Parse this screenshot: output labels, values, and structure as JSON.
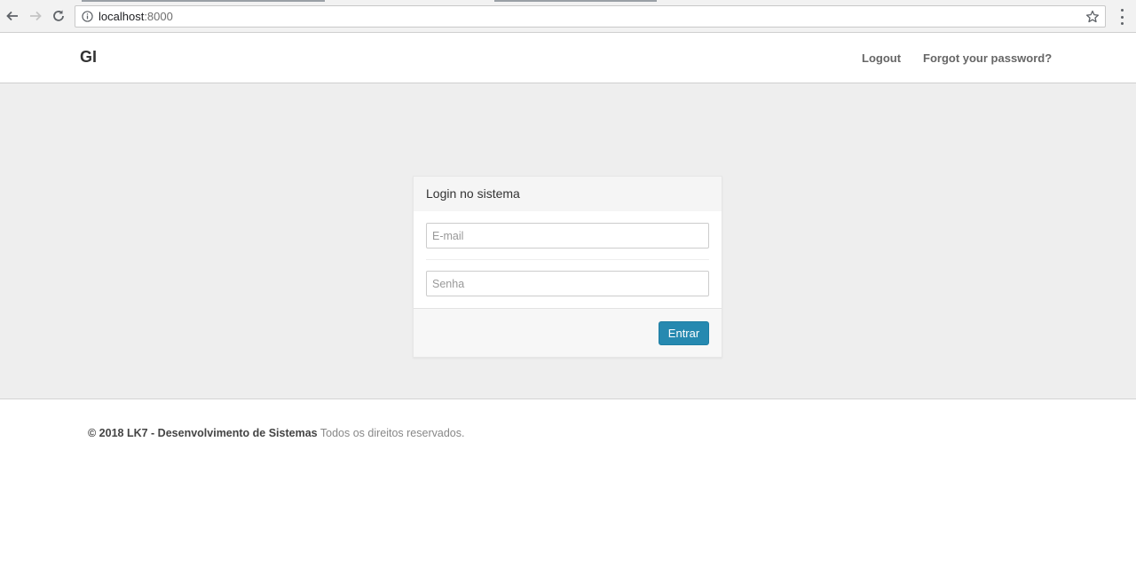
{
  "browser": {
    "url_host": "localhost",
    "url_port": ":8000",
    "icons": {
      "back": "arrow-left-icon",
      "forward": "arrow-right-icon",
      "reload": "reload-icon",
      "info": "info-icon",
      "bookmark": "star-icon",
      "menu": "vertical-dots-icon"
    }
  },
  "navbar": {
    "brand": "GI",
    "links": [
      {
        "label": "Logout"
      },
      {
        "label": "Forgot your password?"
      }
    ]
  },
  "login_panel": {
    "title": "Login no sistema",
    "email": {
      "placeholder": "E-mail",
      "value": ""
    },
    "password": {
      "placeholder": "Senha",
      "value": ""
    },
    "submit_label": "Entrar"
  },
  "footer": {
    "copyright": "© 2018 LK7 - Desenvolvimento de Sistemas",
    "rights": "Todos os direitos reservados."
  },
  "colors": {
    "primary_button": "#2689b0",
    "main_background": "#eeeeee"
  }
}
